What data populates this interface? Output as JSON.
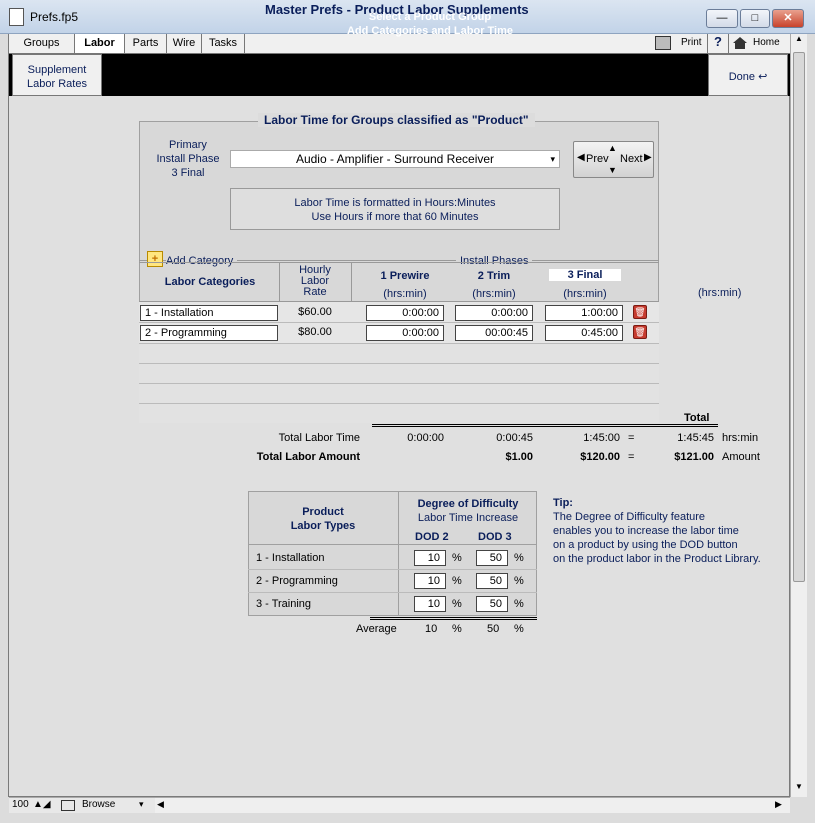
{
  "window": {
    "title": "Prefs.fp5",
    "min": "—",
    "max": "□",
    "close": "✕"
  },
  "nav": {
    "tabs": [
      "Groups",
      "Labor",
      "Parts",
      "Wire",
      "Tasks"
    ],
    "title": "Master Prefs - Product Labor Supplements",
    "print": "Print",
    "help": "?",
    "home": "Home"
  },
  "header": {
    "left_line1": "Supplement",
    "left_line2": "Labor Rates",
    "line1": "Select a Product Group",
    "line2": "Add Categories and Labor Time",
    "done": "Done"
  },
  "panel": {
    "title": "Labor Time for Groups classified as \"Product\"",
    "phase_line1": "Primary",
    "phase_line2": "Install Phase",
    "phase_line3": "3 Final",
    "group_select": "Audio - Amplifier - Surround Receiver",
    "info1": "Labor Time is formatted in Hours:Minutes",
    "info2": "Use Hours if more that 60 Minutes",
    "prev": "Prev",
    "next": "Next",
    "add_category": "Add Category",
    "install_phases": "Install Phases"
  },
  "table": {
    "col_categories": "Labor Categories",
    "col_rate1": "Hourly",
    "col_rate2": "Labor",
    "col_rate3": "Rate",
    "phase1": "1 Prewire",
    "phase2": "2 Trim",
    "phase3": "3 Final",
    "unit": "(hrs:min)",
    "rows": [
      {
        "name": "1 - Installation",
        "rate": "$60.00",
        "p1": "0:00:00",
        "p2": "0:00:00",
        "p3": "1:00:00"
      },
      {
        "name": "2 - Programming",
        "rate": "$80.00",
        "p1": "0:00:00",
        "p2": "00:00:45",
        "p3": "0:45:00"
      }
    ],
    "side_unit": "(hrs:min)"
  },
  "totals": {
    "header": "Total",
    "time_label": "Total Labor Time",
    "time_p1": "0:00:00",
    "time_p2": "0:00:45",
    "time_p3": "1:45:00",
    "eq": "=",
    "time_total": "1:45:45",
    "time_unit": "hrs:min",
    "amount_label": "Total Labor Amount",
    "amount_p2": "$1.00",
    "amount_p3": "$120.00",
    "amount_total": "$121.00",
    "amount_unit": "Amount"
  },
  "dod": {
    "col1_line1": "Product",
    "col1_line2": "Labor Types",
    "col2_line1": "Degree of Difficulty",
    "col2_line2": "Labor Time Increase",
    "dod2": "DOD 2",
    "dod3": "DOD 3",
    "pct": "%",
    "rows": [
      {
        "name": "1 - Installation",
        "d2": "10",
        "d3": "50"
      },
      {
        "name": "2 - Programming",
        "d2": "10",
        "d3": "50"
      },
      {
        "name": "3 - Training",
        "d2": "10",
        "d3": "50"
      }
    ],
    "avg_label": "Average",
    "avg_d2": "10",
    "avg_d3": "50"
  },
  "tip": {
    "title": "Tip:",
    "l1": "The Degree of Difficulty feature",
    "l2": "enables you to increase the labor time",
    "l3": "on a product by using the DOD button",
    "l4": "on the product labor in the Product Library."
  },
  "status": {
    "zoom": "100",
    "mode": "Browse"
  }
}
